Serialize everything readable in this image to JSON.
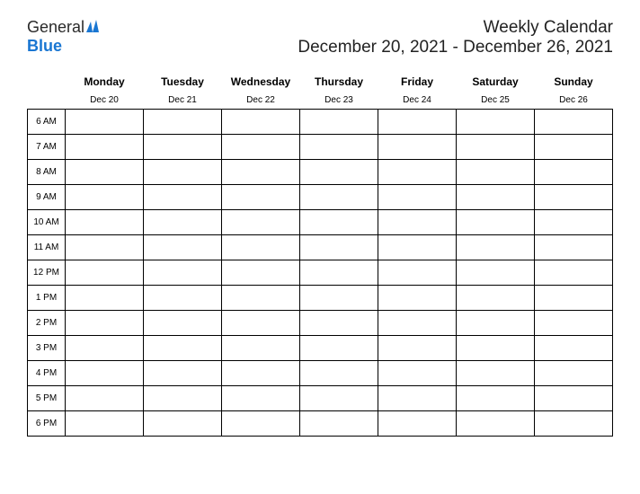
{
  "logo": {
    "text_general": "General",
    "text_blue": "Blue"
  },
  "header": {
    "title": "Weekly Calendar",
    "date_range": "December 20, 2021 - December 26, 2021"
  },
  "days": [
    {
      "name": "Monday",
      "date": "Dec 20"
    },
    {
      "name": "Tuesday",
      "date": "Dec 21"
    },
    {
      "name": "Wednesday",
      "date": "Dec 22"
    },
    {
      "name": "Thursday",
      "date": "Dec 23"
    },
    {
      "name": "Friday",
      "date": "Dec 24"
    },
    {
      "name": "Saturday",
      "date": "Dec 25"
    },
    {
      "name": "Sunday",
      "date": "Dec 26"
    }
  ],
  "hours": [
    "6 AM",
    "7 AM",
    "8 AM",
    "9 AM",
    "10 AM",
    "11 AM",
    "12 PM",
    "1 PM",
    "2 PM",
    "3 PM",
    "4 PM",
    "5 PM",
    "6 PM"
  ]
}
